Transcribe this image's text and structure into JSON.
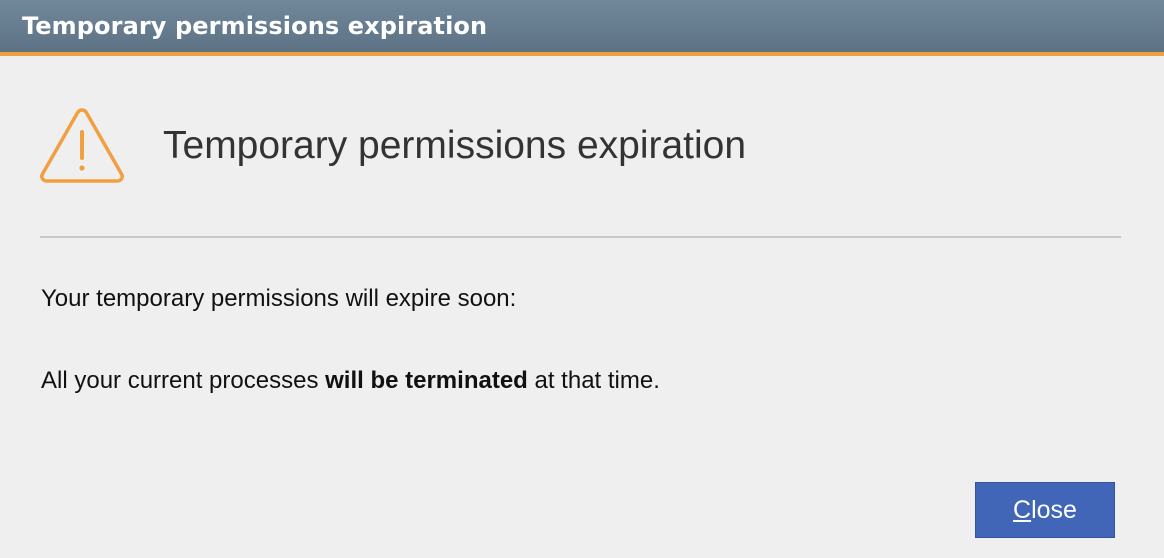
{
  "window": {
    "title": "Temporary permissions expiration"
  },
  "dialog": {
    "icon": "warning-triangle-icon",
    "heading": "Temporary permissions expiration",
    "message_line1": "Your temporary permissions will expire soon:",
    "message_line2_before": "All your current processes ",
    "message_line2_bold": "will be terminated",
    "message_line2_after": " at that time."
  },
  "buttons": {
    "close_mnemonic": "C",
    "close_rest": "lose"
  },
  "colors": {
    "titlebar": "#6a8092",
    "accent_bar": "#f0a040",
    "warning_icon": "#f0a040",
    "button_bg": "#4166b8",
    "background": "#efefef"
  }
}
